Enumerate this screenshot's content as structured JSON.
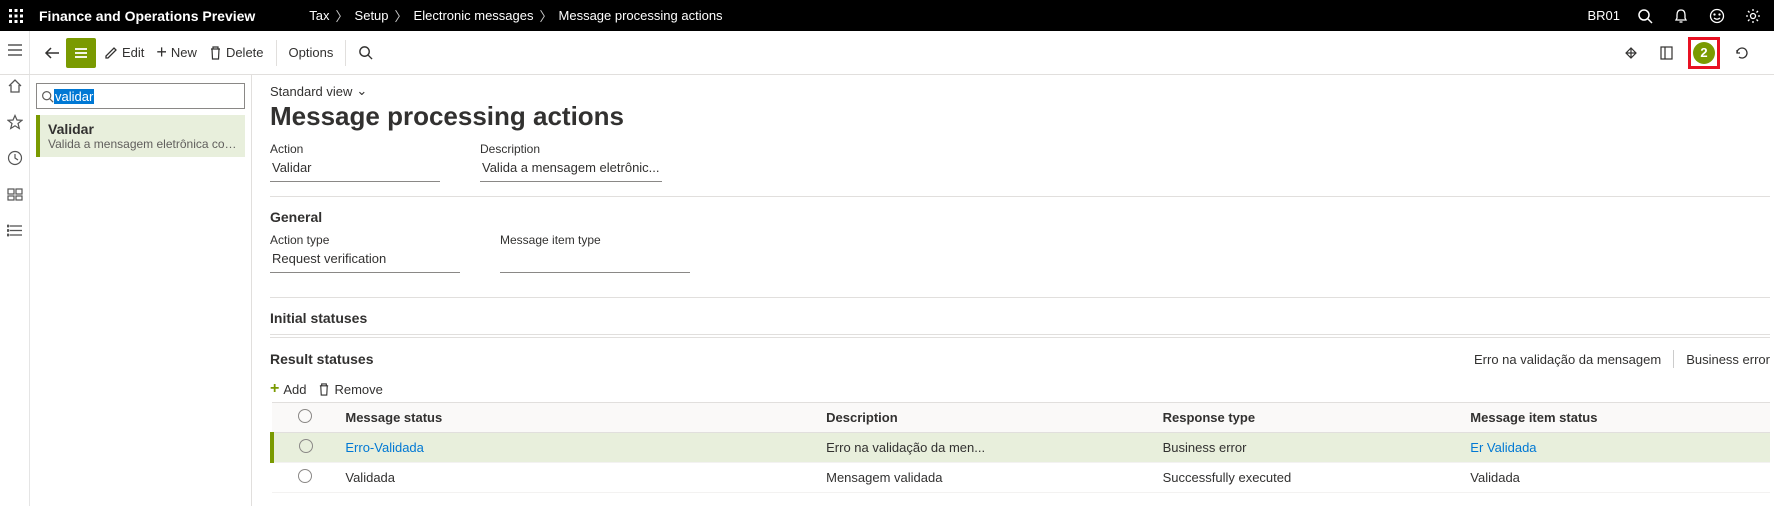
{
  "topbar": {
    "app_title": "Finance and Operations Preview",
    "breadcrumbs": [
      "Tax",
      "Setup",
      "Electronic messages",
      "Message processing actions"
    ],
    "company": "BR01"
  },
  "actionbar": {
    "edit": "Edit",
    "new": "New",
    "delete": "Delete",
    "options": "Options"
  },
  "nav": {
    "filter_value": "validar",
    "item": {
      "title": "Validar",
      "desc": "Valida a mensagem eletrônica com req..."
    }
  },
  "main": {
    "view_label": "Standard view",
    "page_title": "Message processing actions",
    "fields": {
      "action_label": "Action",
      "action_value": "Validar",
      "description_label": "Description",
      "description_value": "Valida a mensagem eletrônic..."
    },
    "general": {
      "header": "General",
      "action_type_label": "Action type",
      "action_type_value": "Request verification",
      "message_item_type_label": "Message item type",
      "message_item_type_value": ""
    },
    "initial_statuses": {
      "header": "Initial statuses"
    },
    "result_statuses": {
      "header": "Result statuses",
      "right_text": "Erro na validação da mensagem",
      "right_text2": "Business error",
      "add": "Add",
      "remove": "Remove",
      "columns": [
        "",
        "Message status",
        "Description",
        "Response type",
        "Message item status"
      ],
      "rows": [
        {
          "status": "Erro-Validada",
          "desc": "Erro na validação da men...",
          "resp": "Business error",
          "item": "Er Validada",
          "selected": true,
          "link": true
        },
        {
          "status": "Validada",
          "desc": "Mensagem validada",
          "resp": "Successfully executed",
          "item": "Validada",
          "selected": false,
          "link": false
        }
      ]
    }
  }
}
